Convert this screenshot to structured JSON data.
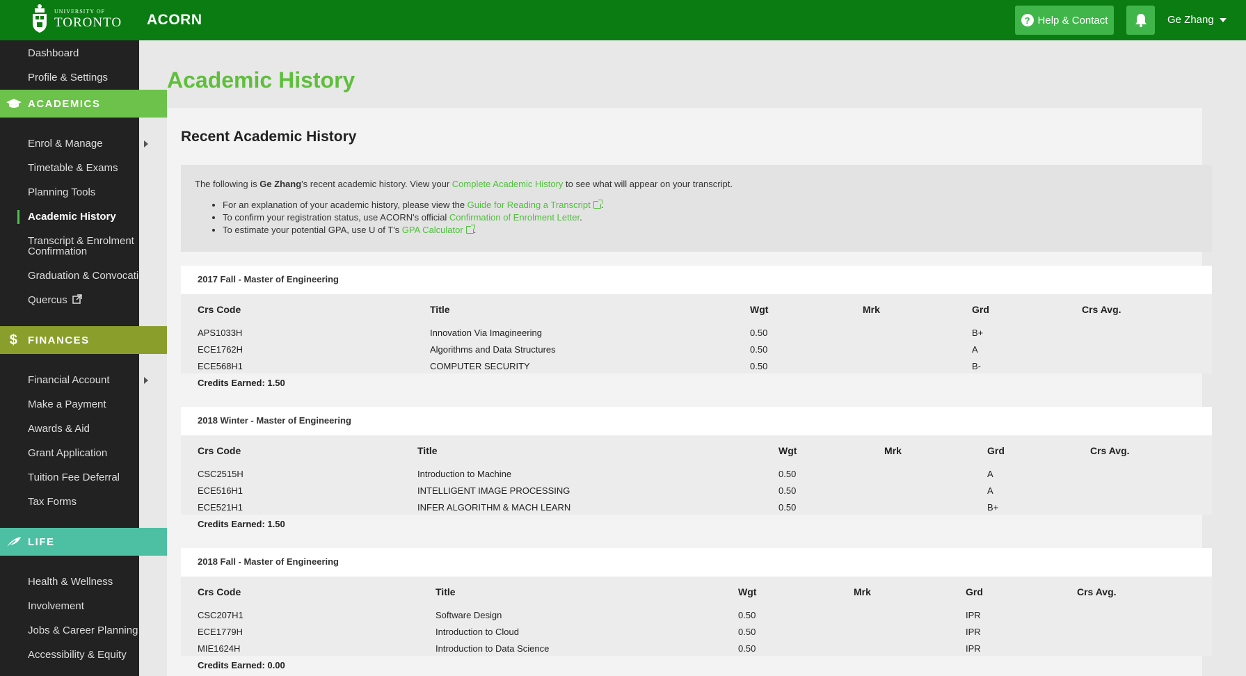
{
  "header": {
    "logo_small": "University of",
    "logo_big": "TORONTO",
    "app_name": "ACORN",
    "help_label": "Help & Contact",
    "user_name": "Ge Zhang"
  },
  "sidebar": {
    "top_items": [
      "Dashboard",
      "Profile & Settings"
    ],
    "academics": {
      "label": "ACADEMICS",
      "items": [
        "Enrol & Manage",
        "Timetable & Exams",
        "Planning Tools",
        "Academic History",
        "Transcript & Enrolment",
        "Confirmation",
        "Graduation & Convocation",
        "Quercus"
      ]
    },
    "finances": {
      "label": "FINANCES",
      "items": [
        "Financial Account",
        "Make a Payment",
        "Awards & Aid",
        "Grant Application",
        "Tuition Fee Deferral",
        "Tax Forms"
      ]
    },
    "life": {
      "label": "LIFE",
      "items": [
        "Health & Wellness",
        "Involvement",
        "Jobs & Career Planning",
        "Accessibility & Equity"
      ]
    }
  },
  "page": {
    "title": "Academic History",
    "heading": "Recent Academic History",
    "intro": {
      "p1_a": "The following is ",
      "p1_name": "Ge Zhang",
      "p1_b": "'s recent academic history. View your ",
      "p1_link": "Complete Academic History",
      "p1_c": " to see what will appear on your transcript.",
      "b1_a": "For an explanation of your academic history, please view the ",
      "b1_link": "Guide for Reading a Transcript",
      "b1_b": ".",
      "b2_a": "To confirm your registration status, use ACORN's official ",
      "b2_link": "Confirmation of Enrolment Letter",
      "b2_b": ".",
      "b3_a": "To estimate your potential GPA, use U of T's ",
      "b3_link": "GPA Calculator",
      "b3_b": "."
    },
    "columns": [
      "Crs Code",
      "Title",
      "Wgt",
      "Mrk",
      "Grd",
      "Crs Avg."
    ],
    "terms": [
      {
        "name": "2017 Fall - Master of Engineering",
        "courses": [
          {
            "code": "APS1033H",
            "title": "Innovation Via Imagineering",
            "wgt": "0.50",
            "grd": "B+"
          },
          {
            "code": "ECE1762H",
            "title": "Algorithms and Data Structures",
            "wgt": "0.50",
            "grd": "A"
          },
          {
            "code": "ECE568H1",
            "title": "COMPUTER SECURITY",
            "wgt": "0.50",
            "grd": "B-"
          }
        ],
        "credits": "Credits Earned: 1.50"
      },
      {
        "name": "2018 Winter - Master of Engineering",
        "courses": [
          {
            "code": "CSC2515H",
            "title": "Introduction to Machine",
            "wgt": "0.50",
            "grd": "A"
          },
          {
            "code": "ECE516H1",
            "title": "INTELLIGENT IMAGE PROCESSING",
            "wgt": "0.50",
            "grd": "A"
          },
          {
            "code": "ECE521H1",
            "title": "INFER ALGORITHM & MACH LEARN",
            "wgt": "0.50",
            "grd": "B+"
          }
        ],
        "credits": "Credits Earned: 1.50"
      },
      {
        "name": "2018 Fall - Master of Engineering",
        "courses": [
          {
            "code": "CSC207H1",
            "title": "Software Design",
            "wgt": "0.50",
            "grd": "IPR"
          },
          {
            "code": "ECE1779H",
            "title": "Introduction to Cloud",
            "wgt": "0.50",
            "grd": "IPR"
          },
          {
            "code": "MIE1624H",
            "title": "Introduction to Data Science",
            "wgt": "0.50",
            "grd": "IPR"
          }
        ],
        "credits": "Credits Earned: 0.00"
      }
    ]
  }
}
